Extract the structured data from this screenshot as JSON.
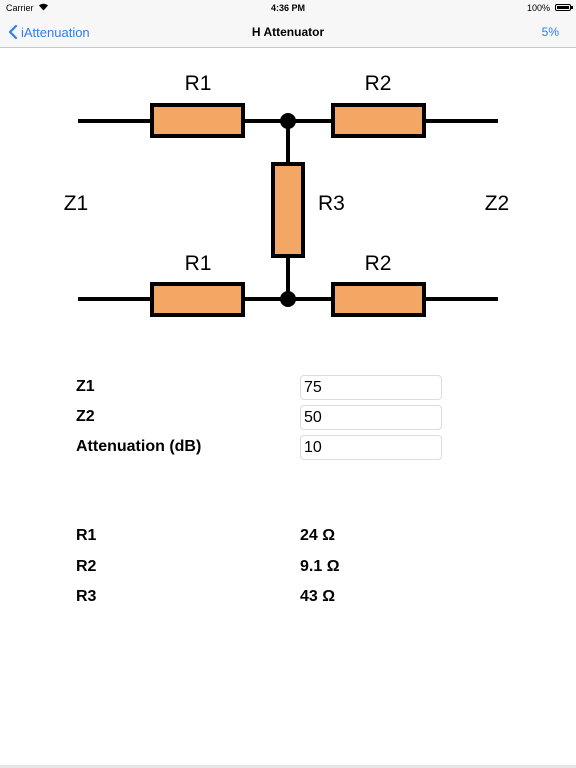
{
  "status_bar": {
    "carrier": "Carrier",
    "time": "4:36 PM",
    "battery": "100%"
  },
  "nav": {
    "back_label": "iAttenuation",
    "title": "H Attenuator",
    "right_label": "5%"
  },
  "diagram": {
    "r1_top": "R1",
    "r2_top": "R2",
    "r3": "R3",
    "r1_bottom": "R1",
    "r2_bottom": "R2",
    "z1": "Z1",
    "z2": "Z2",
    "resistor_color": "#f4a664"
  },
  "form": {
    "fields": [
      {
        "label": "Z1",
        "value": "75"
      },
      {
        "label": "Z2",
        "value": "50"
      },
      {
        "label": "Attenuation (dB)",
        "value": "10"
      }
    ]
  },
  "results": [
    {
      "label": "R1",
      "value": "24 Ω"
    },
    {
      "label": "R2",
      "value": "9.1 Ω"
    },
    {
      "label": "R3",
      "value": "43 Ω"
    }
  ]
}
